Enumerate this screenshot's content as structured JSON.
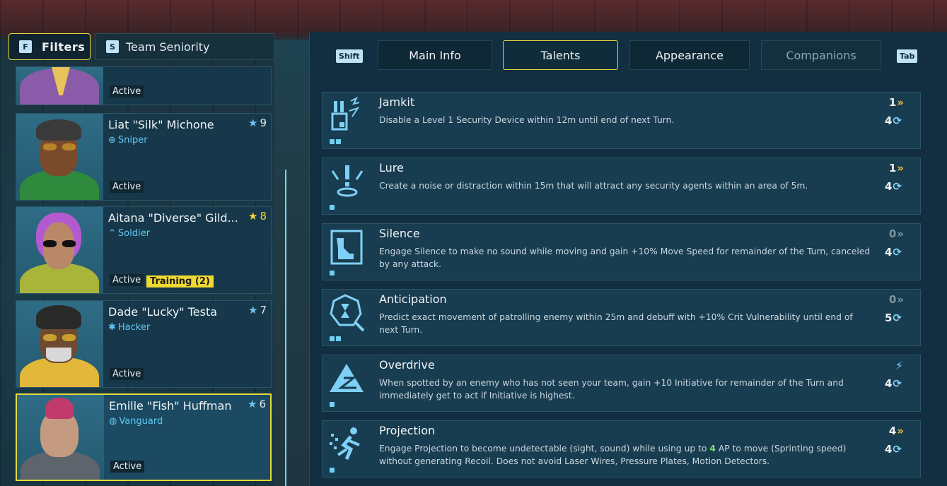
{
  "left": {
    "filters_key": "F",
    "filters_label": "Filters",
    "sort_key": "S",
    "sort_label": "Team Seniority"
  },
  "roster": [
    {
      "name": "",
      "class": "",
      "rank": "",
      "status": "Active"
    },
    {
      "name": "Liat \"Silk\" Michone",
      "class": "Sniper",
      "class_icon": "crosshair-icon",
      "rank": "9",
      "status": "Active"
    },
    {
      "name": "Aitana \"Diverse\" Gild...",
      "class": "Soldier",
      "class_icon": "chevrons-icon",
      "rank": "8",
      "status": "Active",
      "badge": "Training (2)"
    },
    {
      "name": "Dade \"Lucky\" Testa",
      "class": "Hacker",
      "class_icon": "bug-icon",
      "rank": "7",
      "status": "Active"
    },
    {
      "name": "Emille \"Fish\" Huffman",
      "class": "Vanguard",
      "class_icon": "helmet-icon",
      "rank": "6",
      "status": "Active"
    }
  ],
  "tabs": {
    "prev_key": "Shift",
    "next_key": "Tab",
    "items": [
      "Main Info",
      "Talents",
      "Appearance",
      "Companions"
    ],
    "active": "Talents"
  },
  "talents": [
    {
      "name": "Jamkit",
      "icon": "jamkit-icon",
      "desc": "Disable a Level 1 Security Device within 12m until end of next Turn.",
      "ap": "1",
      "cooldown": "4",
      "pips": 2
    },
    {
      "name": "Lure",
      "icon": "lure-icon",
      "desc": "Create a noise or distraction within 15m that will attract any security agents within an area of 5m.",
      "ap": "1",
      "cooldown": "4",
      "pips": 1
    },
    {
      "name": "Silence",
      "icon": "silence-icon",
      "desc": "Engage Silence to make no sound while moving and gain +10% Move Speed for remainder of the Turn, canceled by any attack.",
      "ap": "0",
      "cooldown": "4",
      "pips": 1
    },
    {
      "name": "Anticipation",
      "icon": "anticipation-icon",
      "desc": "Predict exact movement of patrolling enemy within 25m and debuff with +10% Crit Vulnerability until end of next Turn.",
      "ap": "0",
      "cooldown": "5",
      "pips": 2
    },
    {
      "name": "Overdrive",
      "icon": "overdrive-icon",
      "desc": "When spotted by an enemy who has not seen your team, gain +10 Initiative for remainder of the Turn and immediately get to act if Initiative is highest.",
      "ap": "",
      "cooldown": "4",
      "pips": 1
    },
    {
      "name": "Projection",
      "icon": "projection-icon",
      "desc_before": "Engage Projection to become undetectable (sight, sound) while using up to ",
      "desc_highlight": "4",
      "desc_after": " AP to move (Sprinting speed) without generating Recoil. Does not avoid Laser Wires, Pressure Plates, Motion Detectors.",
      "ap": "4",
      "cooldown": "4",
      "pips": 1
    }
  ],
  "colors": {
    "accent_yellow": "#e6db3c",
    "class_blue": "#5fc8f5",
    "ap_chevron": "#f2c23a",
    "highlight_green": "#7fe06a"
  }
}
